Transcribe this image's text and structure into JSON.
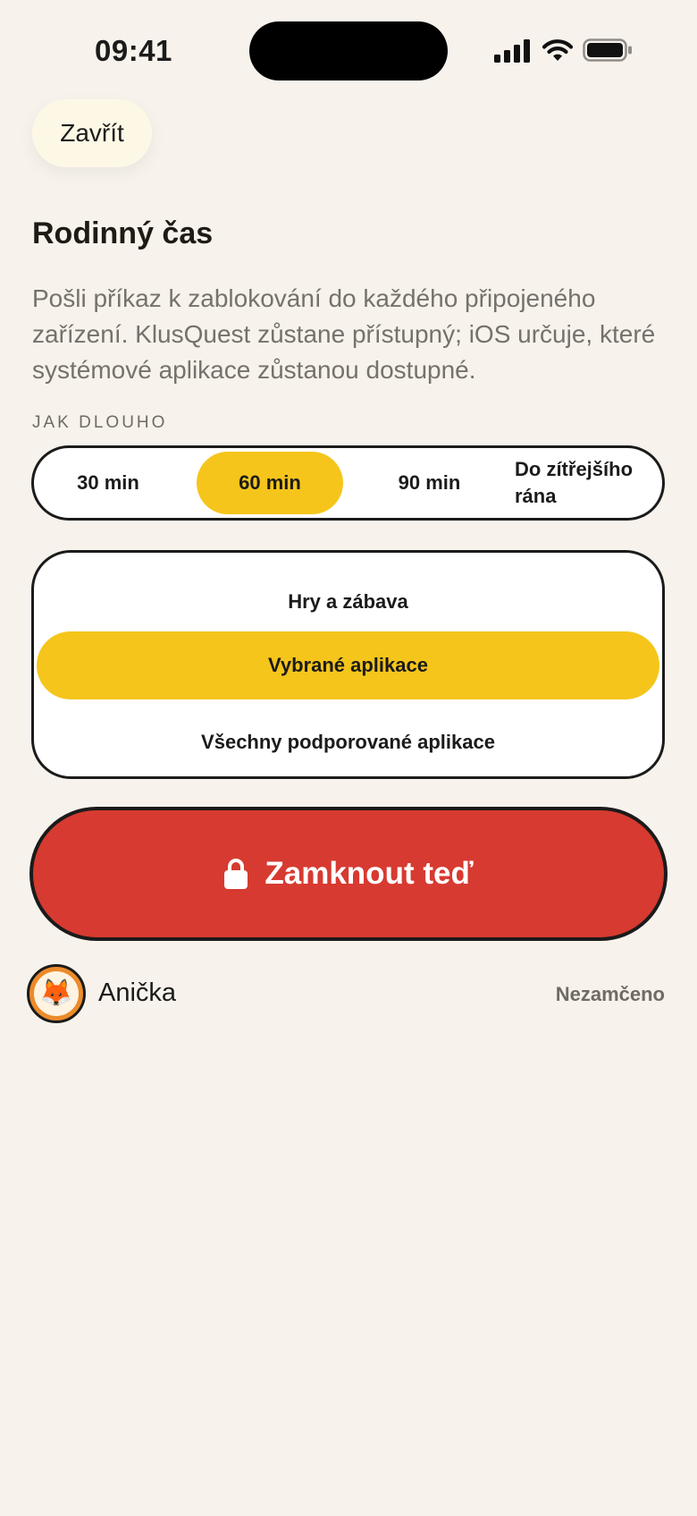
{
  "status_bar": {
    "time": "09:41",
    "icons": [
      "signal-icon",
      "wifi-icon",
      "battery-icon"
    ]
  },
  "header": {
    "close_label": "Zavřít"
  },
  "main": {
    "title": "Rodinný čas",
    "description": "Pošli příkaz k zablokování do každého připojeného zařízení. KlusQuest zůstane přístupný; iOS určuje, které systémové aplikace zůstanou dostupné.",
    "duration_label": "JAK DLOUHO",
    "durations": [
      {
        "label": "30 min",
        "selected": false
      },
      {
        "label": "60 min",
        "selected": true
      },
      {
        "label": "90 min",
        "selected": false
      },
      {
        "label": "Do zítřejšího rána",
        "selected": false
      }
    ],
    "scopes": [
      {
        "label": "Hry a zábava",
        "selected": false
      },
      {
        "label": "Vybrané aplikace",
        "selected": true
      },
      {
        "label": "Všechny podporované aplikace",
        "selected": false
      }
    ],
    "lock_button": {
      "label": "Zamknout teď",
      "icon": "lock-icon"
    }
  },
  "children": [
    {
      "name": "Anička",
      "avatar": "fox-icon",
      "status": "Nezamčeno"
    }
  ],
  "colors": {
    "background": "#f7f3ec",
    "accent_yellow": "#f5c51b",
    "lock_red": "#d73a30",
    "avatar_orange": "#ec8b2a"
  }
}
